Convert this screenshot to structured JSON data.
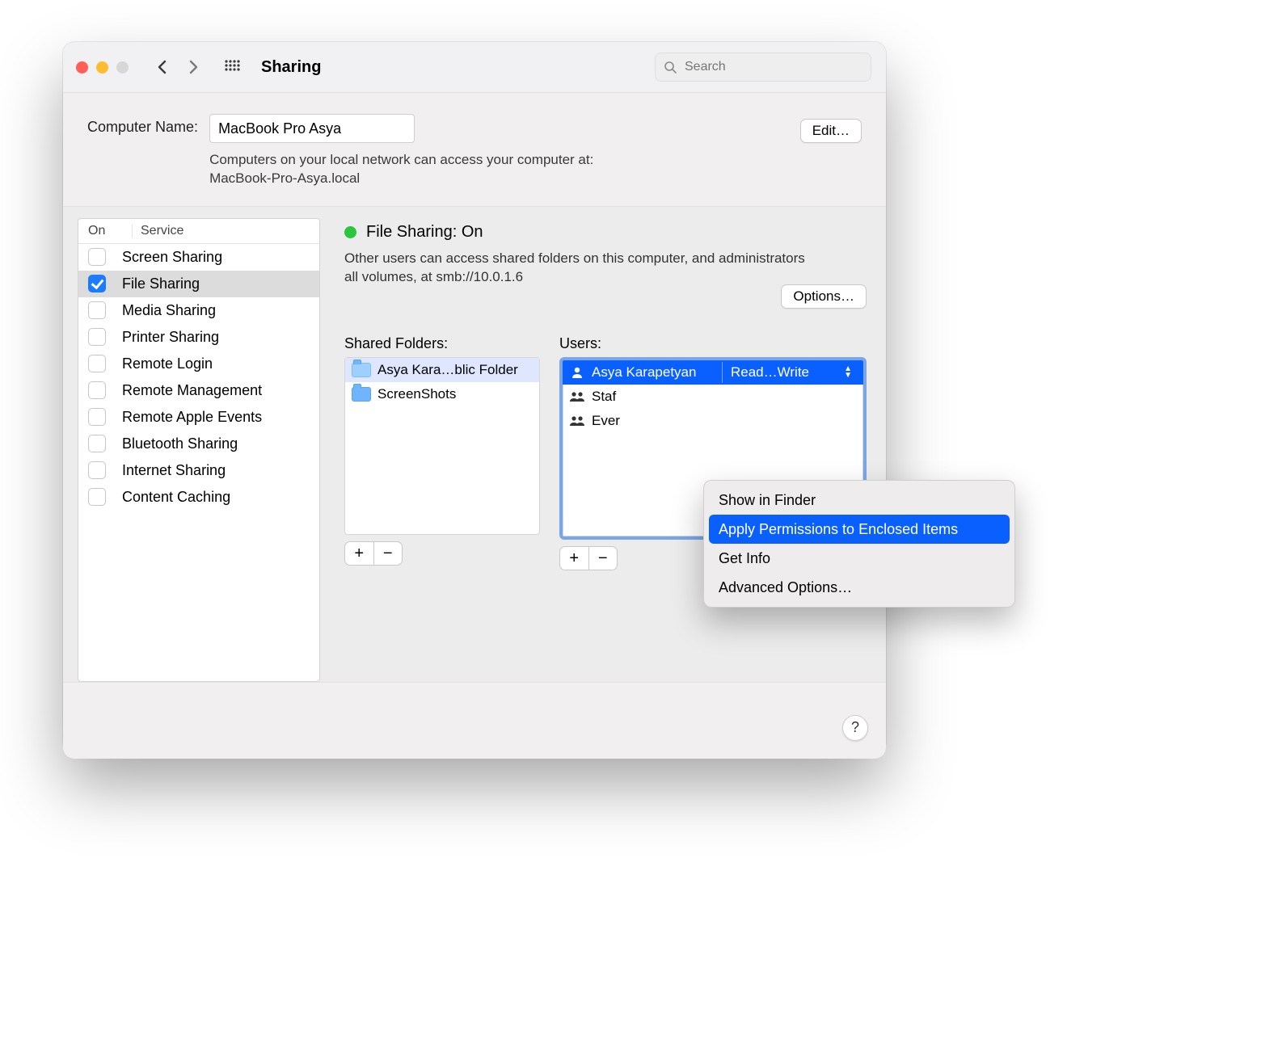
{
  "window": {
    "title": "Sharing"
  },
  "search": {
    "placeholder": "Search"
  },
  "computer_name": {
    "label": "Computer Name:",
    "value": "MacBook Pro Asya",
    "note_line1": "Computers on your local network can access your computer at:",
    "note_line2": "MacBook-Pro-Asya.local",
    "edit_label": "Edit…"
  },
  "services": {
    "col_on": "On",
    "col_service": "Service",
    "items": [
      {
        "label": "Screen Sharing",
        "on": false,
        "selected": false
      },
      {
        "label": "File Sharing",
        "on": true,
        "selected": true
      },
      {
        "label": "Media Sharing",
        "on": false,
        "selected": false
      },
      {
        "label": "Printer Sharing",
        "on": false,
        "selected": false
      },
      {
        "label": "Remote Login",
        "on": false,
        "selected": false
      },
      {
        "label": "Remote Management",
        "on": false,
        "selected": false
      },
      {
        "label": "Remote Apple Events",
        "on": false,
        "selected": false
      },
      {
        "label": "Bluetooth Sharing",
        "on": false,
        "selected": false
      },
      {
        "label": "Internet Sharing",
        "on": false,
        "selected": false
      },
      {
        "label": "Content Caching",
        "on": false,
        "selected": false
      }
    ]
  },
  "status": {
    "title": "File Sharing: On",
    "desc": "Other users can access shared folders on this computer, and administrators all volumes, at smb://10.0.1.6"
  },
  "options_label": "Options…",
  "shared_folders": {
    "caption": "Shared Folders:",
    "items": [
      {
        "label": "Asya Kara…blic Folder",
        "selected": true
      },
      {
        "label": "ScreenShots",
        "selected": false
      }
    ]
  },
  "users": {
    "caption": "Users:",
    "items": [
      {
        "label": "Asya Karapetyan",
        "perm": "Read…Write",
        "kind": "user",
        "selected": true
      },
      {
        "label": "Staf",
        "perm": "",
        "kind": "group",
        "selected": false
      },
      {
        "label": "Ever",
        "perm": "",
        "kind": "group",
        "selected": false
      }
    ]
  },
  "context_menu": {
    "items": [
      {
        "label": "Show in Finder",
        "selected": false
      },
      {
        "label": "Apply Permissions to Enclosed Items",
        "selected": true
      },
      {
        "label": "Get Info",
        "selected": false
      },
      {
        "label": "Advanced Options…",
        "selected": false
      }
    ]
  },
  "help_label": "?"
}
